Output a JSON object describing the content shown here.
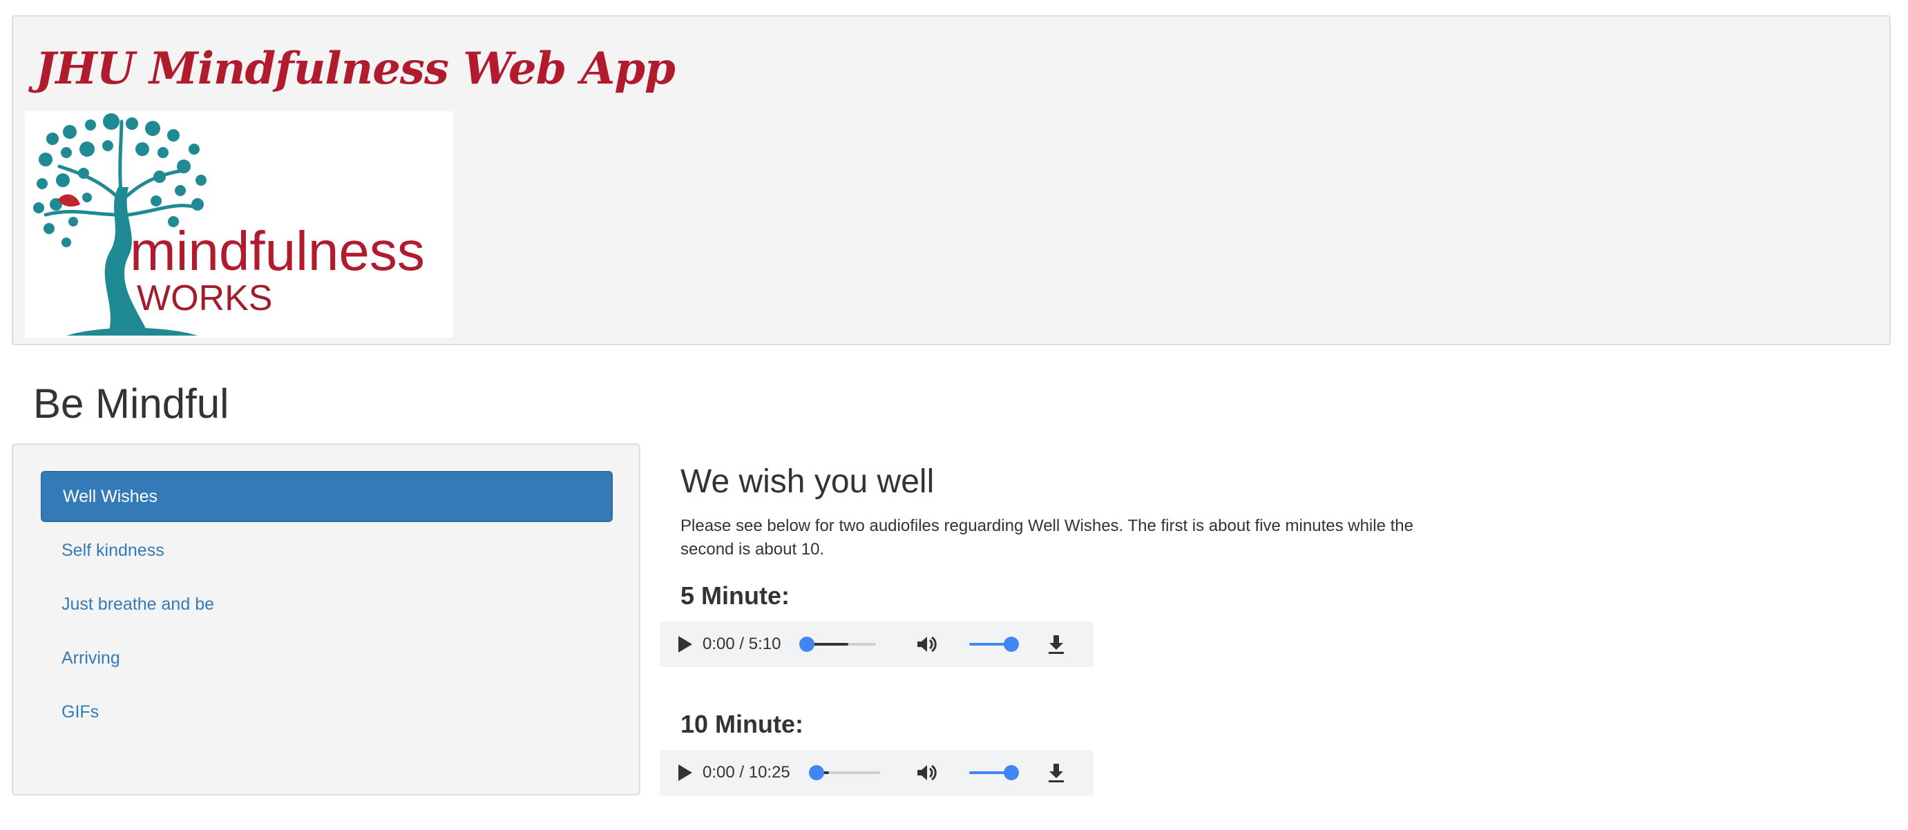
{
  "header": {
    "app_title": "JHU Mindfulness Web App",
    "logo": {
      "text_main": "mindfulness",
      "text_sub": "WORKS"
    }
  },
  "page": {
    "title": "Be Mindful"
  },
  "sidebar": {
    "items": [
      {
        "label": "Well Wishes",
        "active": true
      },
      {
        "label": "Self kindness",
        "active": false
      },
      {
        "label": "Just breathe and be",
        "active": false
      },
      {
        "label": "Arriving",
        "active": false
      },
      {
        "label": "GIFs",
        "active": false
      }
    ]
  },
  "content": {
    "title": "We wish you well",
    "description": "Please see below for two audiofiles reguarding Well Wishes. The first is about five minutes while the second is about 10.",
    "audio": [
      {
        "heading": "5 Minute:",
        "time": "0:00 / 5:10",
        "buffered": 0.6,
        "progress": 0
      },
      {
        "heading": "10 Minute:",
        "time": "0:00 / 10:25",
        "buffered": 0.2,
        "progress": 0
      }
    ]
  },
  "colors": {
    "brand_red": "#b01c2e",
    "accent_blue": "#337ab7",
    "player_blue": "#4285f4",
    "logo_teal": "#1f8a93"
  },
  "icons": {
    "play": "play-icon",
    "volume": "volume-icon",
    "download": "download-icon"
  }
}
